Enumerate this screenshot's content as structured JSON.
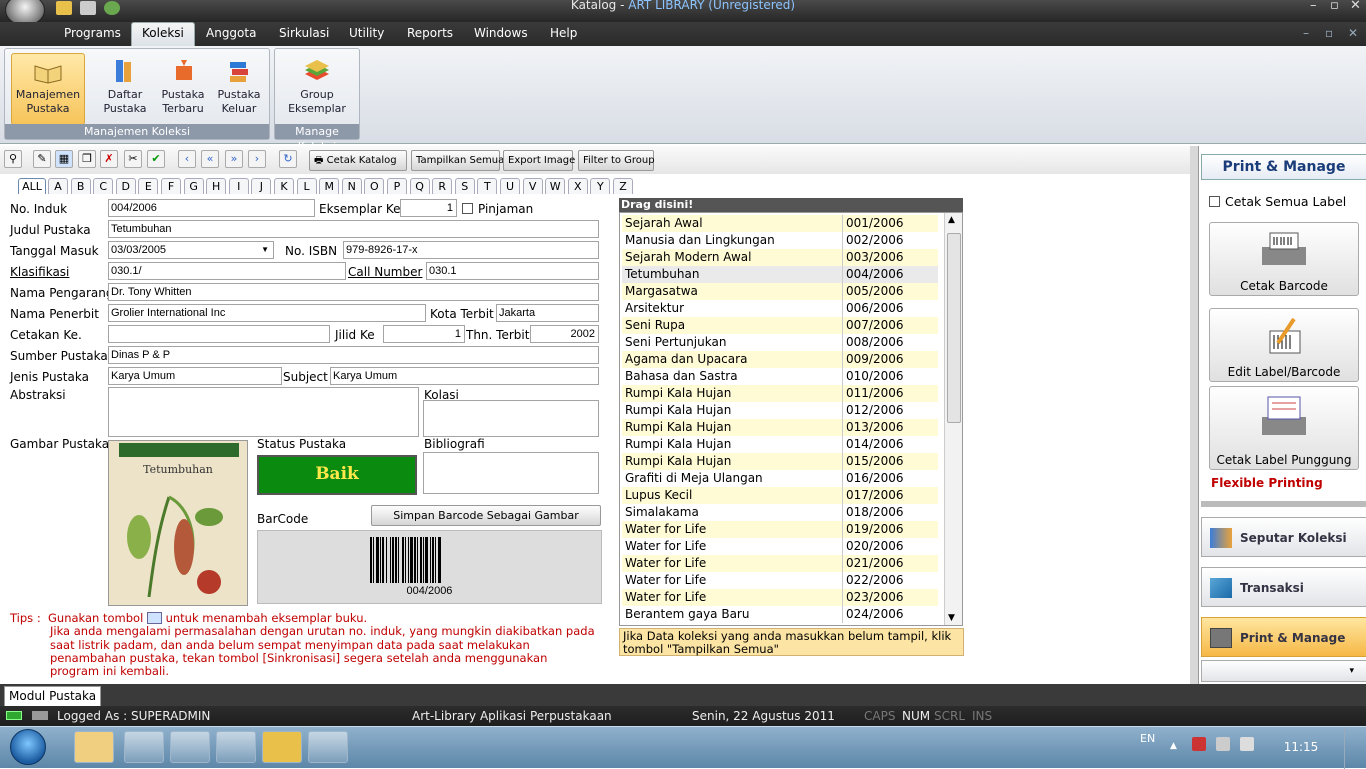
{
  "window": {
    "title": "Katalog - ",
    "title_accent": "ART LIBRARY (Unregistered)"
  },
  "menu": {
    "items": [
      "Programs",
      "Koleksi",
      "Anggota",
      "Sirkulasi",
      "Utility",
      "Reports",
      "Windows",
      "Help"
    ],
    "active": "Koleksi"
  },
  "ribbon": {
    "group1": {
      "label": "Manajemen Koleksi",
      "buttons": [
        {
          "line1": "Manajemen",
          "line2": "Pustaka"
        },
        {
          "line1": "Daftar",
          "line2": "Pustaka"
        },
        {
          "line1": "Pustaka",
          "line2": "Terbaru"
        },
        {
          "line1": "Pustaka",
          "line2": "Keluar"
        }
      ]
    },
    "group2": {
      "label": "Manage Koleksi",
      "buttons": [
        {
          "line1": "Group",
          "line2": "Eksemplar"
        }
      ]
    }
  },
  "toolbar": {
    "cetak_katalog": "Cetak Katalog",
    "tampilkan_semua": "Tampilkan Semua",
    "export_image": "Export Image",
    "filter_group": "Filter to Group"
  },
  "alpha_tabs": [
    "ALL",
    "A",
    "B",
    "C",
    "D",
    "E",
    "F",
    "G",
    "H",
    "I",
    "J",
    "K",
    "L",
    "M",
    "N",
    "O",
    "P",
    "Q",
    "R",
    "S",
    "T",
    "U",
    "V",
    "W",
    "X",
    "Y",
    "Z"
  ],
  "form": {
    "no_induk_label": "No. Induk",
    "no_induk": "004/2006",
    "eksemplar_label": "Eksemplar Ke",
    "eksemplar": "1",
    "pinjaman_label": "Pinjaman",
    "judul_label": "Judul Pustaka",
    "judul": "Tetumbuhan",
    "tanggal_label": "Tanggal Masuk",
    "tanggal": "03/03/2005",
    "isbn_label": "No. ISBN",
    "isbn": "979-8926-17-x",
    "klasifikasi_label": "Klasifikasi",
    "klasifikasi": "030.1/",
    "call_label": "Call Number",
    "call": "030.1",
    "pengarang_label": "Nama Pengarang",
    "pengarang": "Dr. Tony Whitten",
    "penerbit_label": "Nama Penerbit",
    "penerbit": "Grolier International Inc",
    "kota_label": "Kota Terbit",
    "kota": "Jakarta",
    "cetakan_label": "Cetakan Ke.",
    "cetakan": "",
    "jilid_label": "Jilid Ke",
    "jilid": "1",
    "thn_label": "Thn. Terbit",
    "thn": "2002",
    "sumber_label": "Sumber Pustaka",
    "sumber": "Dinas P & P",
    "jenis_label": "Jenis Pustaka",
    "jenis": "Karya Umum",
    "subject_label": "Subject",
    "subject": "Karya Umum",
    "abstraksi_label": "Abstraksi",
    "kolasi_label": "Kolasi",
    "gambar_label": "Gambar Pustaka",
    "status_label": "Status Pustaka",
    "status": "Baik",
    "bibliografi_label": "Bibliografi",
    "barcode_label": "BarCode",
    "simpan_barcode": "Simpan Barcode Sebagai Gambar",
    "barcode_text": "004/2006",
    "cover_title": "Tetumbuhan"
  },
  "tips": {
    "prefix": "Tips :",
    "line1a": "Gunakan tombol",
    "line1b": "untuk menambah eksemplar buku.",
    "lines": [
      "Jika anda mengalami permasalahan dengan urutan no. induk, yang mungkin diakibatkan pada",
      "saat listrik padam, dan anda belum sempat menyimpan data pada saat melakukan",
      "penambahan pustaka, tekan tombol [Sinkronisasi] segera setelah anda menggunakan",
      "program ini kembali."
    ]
  },
  "list": {
    "header": "Drag disini!",
    "rows": [
      {
        "title": "Sejarah Awal",
        "code": "001/2006"
      },
      {
        "title": "Manusia dan Lingkungan",
        "code": "002/2006"
      },
      {
        "title": "Sejarah Modern Awal",
        "code": "003/2006"
      },
      {
        "title": "Tetumbuhan",
        "code": "004/2006"
      },
      {
        "title": "Margasatwa",
        "code": "005/2006"
      },
      {
        "title": "Arsitektur",
        "code": "006/2006"
      },
      {
        "title": "Seni Rupa",
        "code": "007/2006"
      },
      {
        "title": "Seni Pertunjukan",
        "code": "008/2006"
      },
      {
        "title": "Agama dan Upacara",
        "code": "009/2006"
      },
      {
        "title": "Bahasa dan Sastra",
        "code": "010/2006"
      },
      {
        "title": "Rumpi Kala Hujan",
        "code": "011/2006"
      },
      {
        "title": "Rumpi Kala Hujan",
        "code": "012/2006"
      },
      {
        "title": "Rumpi Kala Hujan",
        "code": "013/2006"
      },
      {
        "title": "Rumpi Kala Hujan",
        "code": "014/2006"
      },
      {
        "title": "Rumpi Kala Hujan",
        "code": "015/2006"
      },
      {
        "title": "Grafiti di Meja Ulangan",
        "code": "016/2006"
      },
      {
        "title": "Lupus Kecil",
        "code": "017/2006"
      },
      {
        "title": "Simalakama",
        "code": "018/2006"
      },
      {
        "title": "Water for Life",
        "code": "019/2006"
      },
      {
        "title": "Water for Life",
        "code": "020/2006"
      },
      {
        "title": "Water for Life",
        "code": "021/2006"
      },
      {
        "title": "Water for Life",
        "code": "022/2006"
      },
      {
        "title": "Water for Life",
        "code": "023/2006"
      },
      {
        "title": "Berantem gaya Baru",
        "code": "024/2006"
      }
    ],
    "note": "Jika Data koleksi yang anda masukkan belum tampil, klik tombol \"Tampilkan Semua\""
  },
  "right": {
    "header": "Print & Manage",
    "cetak_semua": "Cetak Semua Label",
    "btn1": "Cetak Barcode",
    "btn2": "Edit Label/Barcode",
    "btn3": "Cetak Label Punggung",
    "flexible": "Flexible Printing",
    "nav1": "Seputar Koleksi",
    "nav2": "Transaksi",
    "nav3": "Print & Manage"
  },
  "module_tab": "Modul Pustaka",
  "status": {
    "logged": "Logged As : SUPERADMIN",
    "app": "Art-Library Aplikasi Perpustakaan",
    "date": "Senin, 22 Agustus 2011",
    "caps": "CAPS",
    "num": "NUM",
    "scrl": "SCRL",
    "ins": "INS"
  },
  "taskbar": {
    "lang": "EN",
    "time": "11:15"
  },
  "colors": {
    "accent": "#f7c45a",
    "title_accent": "#8cc4ff",
    "status_ok": "#0b8a10",
    "tips": "#c00000"
  }
}
